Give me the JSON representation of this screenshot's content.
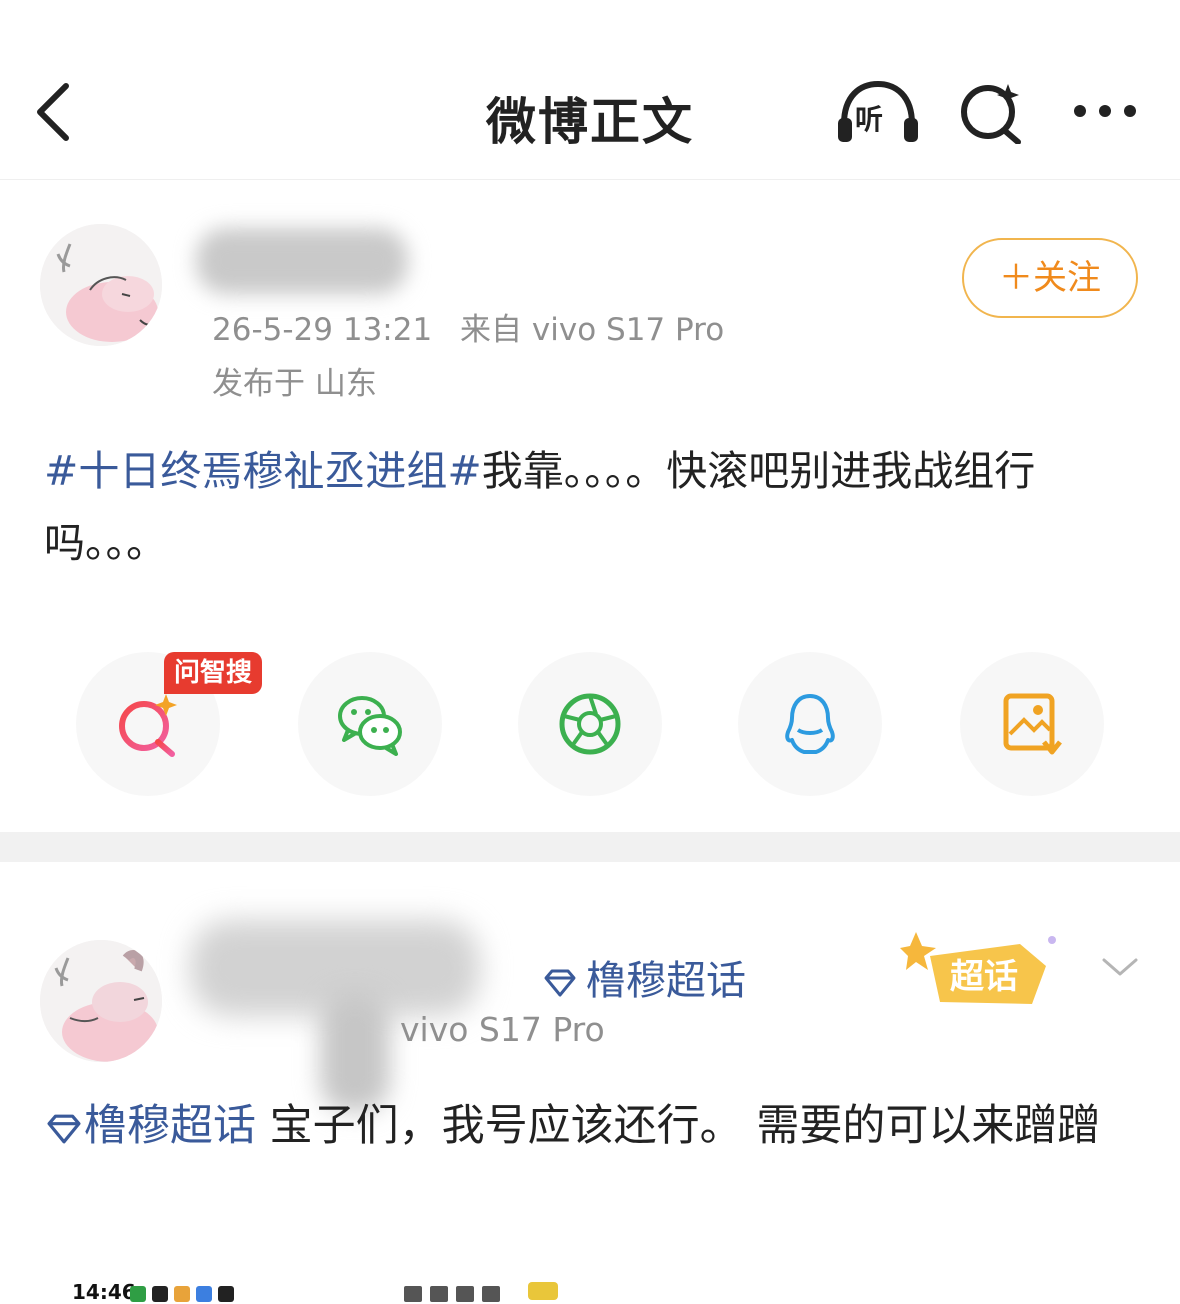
{
  "header": {
    "title": "微博正文",
    "listen_label": "听"
  },
  "post": {
    "timestamp": "26-5-29 13:21",
    "source": "来自 vivo S17 Pro",
    "location": "发布于 山东",
    "follow_label": "＋关注",
    "hashtag": "#十日终焉穆祉丞进组#",
    "body_text": "我靠。。。。快滚吧别进我战组行吗。。。",
    "share_badge": "问智搜"
  },
  "share_bar": {
    "items": [
      "search-ai",
      "wechat",
      "moments",
      "qq",
      "save-image"
    ]
  },
  "post2": {
    "supertopic_tag": "橹穆超话",
    "device_visible": "vivo S17 Pro",
    "super_badge_label": "超话",
    "topic_link": "橹穆超话",
    "body_text": " 宝子们，我号应该还行。 需要的可以来蹭蹭"
  },
  "status_bar": {
    "time": "14:46"
  },
  "colors": {
    "link": "#3a5a9a",
    "follow_orange": "#f08a1c",
    "badge_red": "#e73b2f",
    "muted": "#8f8f8f"
  }
}
